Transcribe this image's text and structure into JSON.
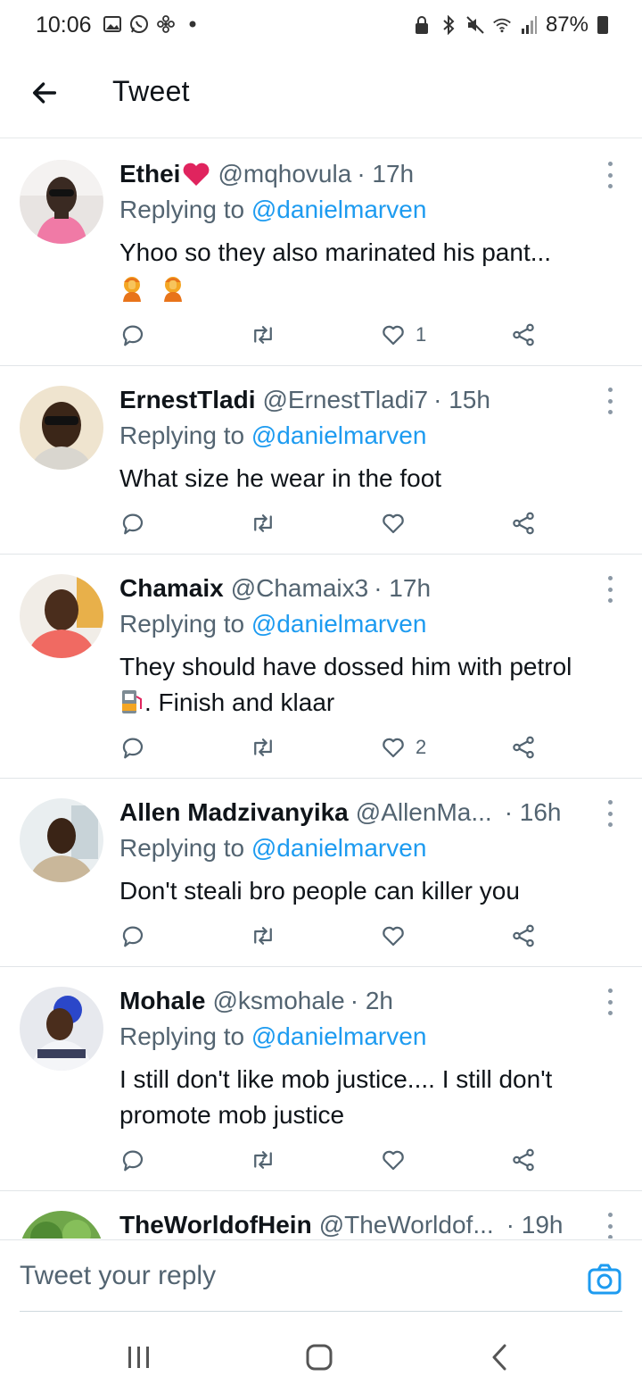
{
  "status_bar": {
    "time": "10:06",
    "battery": "87%",
    "left_icons": [
      "gallery-icon",
      "whatsapp-icon",
      "fan-icon",
      "dot-icon"
    ],
    "right_icons": [
      "lock-icon",
      "bluetooth-icon",
      "mute-icon",
      "wifi-icon",
      "signal-icon",
      "battery-icon"
    ]
  },
  "header": {
    "title": "Tweet"
  },
  "tweets": [
    {
      "name": "Ethei",
      "handle": "@mqhovula",
      "time": "· 17h",
      "replying_prefix": "Replying to",
      "replying_to": "@danielmarven",
      "text": "Yhoo so they also marinated his pant...",
      "likes": "1"
    },
    {
      "name": "ErnestTladi",
      "handle": "@ErnestTladi7",
      "time": "· 15h",
      "replying_prefix": "Replying to",
      "replying_to": "@danielmarven",
      "text": "What size he wear in the foot",
      "likes": ""
    },
    {
      "name": "Chamaix",
      "handle": "@Chamaix3",
      "time": "· 17h",
      "replying_prefix": "Replying to",
      "replying_to": "@danielmarven",
      "text_line1": "They should have dossed him with petrol",
      "text_line2": ". Finish and klaar",
      "likes": "2"
    },
    {
      "name": "Allen Madzivanyika",
      "handle": "@AllenMa...",
      "time": "· 16h",
      "replying_prefix": "Replying to",
      "replying_to": "@danielmarven",
      "text": "Don't steali bro people can killer you",
      "likes": ""
    },
    {
      "name": "Mohale",
      "handle": "@ksmohale",
      "time": "· 2h",
      "replying_prefix": "Replying to",
      "replying_to": "@danielmarven",
      "text": "I still don't like mob justice.... I still don't promote mob justice",
      "likes": ""
    },
    {
      "name": "TheWorldofHein",
      "handle": "@TheWorldof...",
      "time": "· 19h"
    }
  ],
  "reply": {
    "placeholder": "Tweet your reply"
  },
  "colors": {
    "accent": "#1d9bf0",
    "secondary_text": "#536471",
    "primary_text": "#0f1419",
    "heart_emoji": "#e0245e"
  }
}
